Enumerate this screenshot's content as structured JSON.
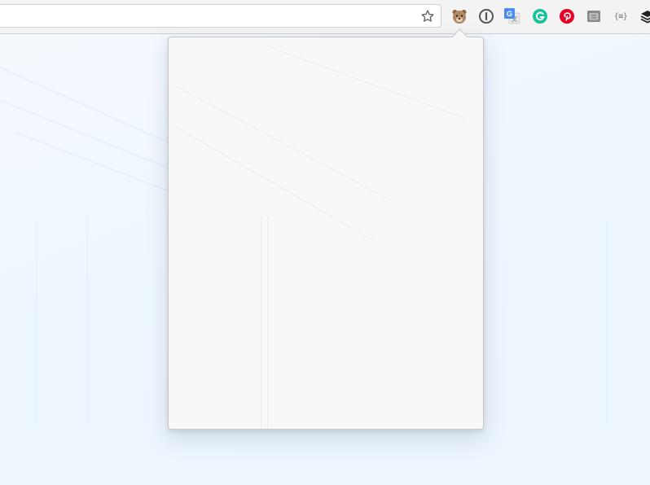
{
  "toolbar": {
    "bookmark_star": "star-icon",
    "extensions": [
      {
        "name": "bear-extension-icon",
        "color": "#b08763"
      },
      {
        "name": "password-manager-icon",
        "color": "#555555"
      },
      {
        "name": "google-translate-icon",
        "color": "#4a8df6"
      },
      {
        "name": "grammarly-icon",
        "color": "#15c39a"
      },
      {
        "name": "pinterest-icon",
        "color": "#e60023"
      },
      {
        "name": "gray-extension-icon",
        "color": "#8a8a8a"
      },
      {
        "name": "json-viewer-icon",
        "color": "#777777"
      },
      {
        "name": "buffer-icon",
        "color": "#222222"
      }
    ]
  },
  "json_viewer_glyph": "{≡}",
  "popup": {
    "content": ""
  }
}
